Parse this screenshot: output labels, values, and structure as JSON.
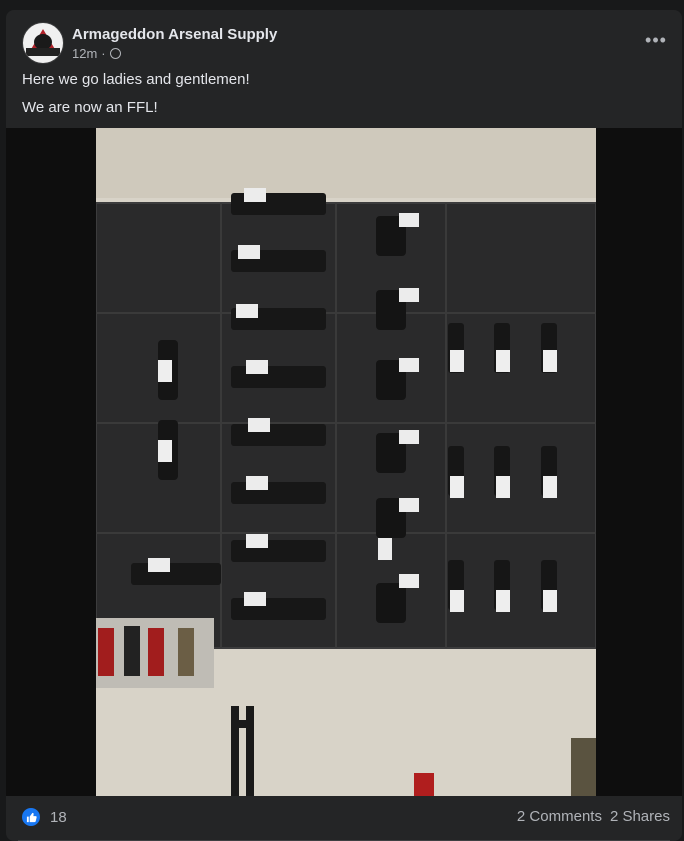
{
  "post": {
    "page_name": "Armageddon Arsenal Supply",
    "timestamp": "12m",
    "separator": "·",
    "privacy_icon": "globe-icon",
    "more_icon": "more-options-icon",
    "more_label": "•••",
    "lines": [
      "Here we go ladies and gentlemen!",
      "We are now an FFL!"
    ]
  },
  "reactions": {
    "icon": "like-icon",
    "count": "18",
    "comments": "2 Comments",
    "shares": "2 Shares"
  },
  "colors": {
    "background": "#18191a",
    "card": "#242526",
    "text": "#e4e6eb",
    "secondary_text": "#b0b3b8",
    "like_blue": "#1877f2"
  }
}
